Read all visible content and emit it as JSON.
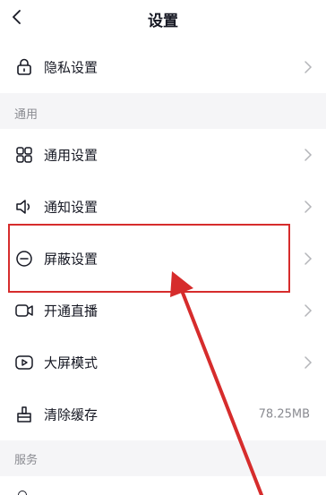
{
  "header": {
    "title": "设置"
  },
  "privacy": {
    "label": "隐私设置"
  },
  "sections": {
    "general_title": "通用",
    "service_title": "服务"
  },
  "rows": [
    {
      "label": "通用设置"
    },
    {
      "label": "通知设置"
    },
    {
      "label": "屏蔽设置"
    },
    {
      "label": "开通直播"
    },
    {
      "label": "大屏模式"
    },
    {
      "label": "清除缓存",
      "value": "78.25MB"
    }
  ],
  "colors": {
    "highlight": "#d62c2c",
    "section_bg": "#f5f5f7"
  }
}
